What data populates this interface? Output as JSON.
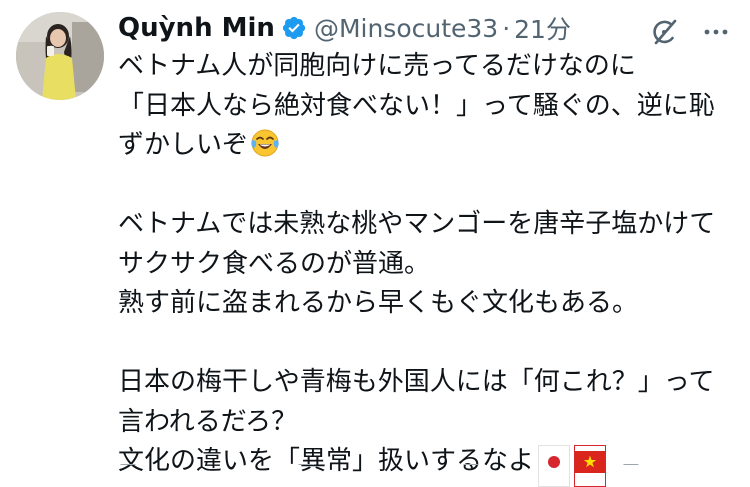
{
  "tweet": {
    "display_name": "Quỳnh Min",
    "handle": "@Minsocute33",
    "separator": "·",
    "time": "21分",
    "icons": {
      "verified": "verified-badge-icon",
      "grok": "grok-icon",
      "more": "more-options-icon"
    },
    "colors": {
      "verified": "#1d9bf0",
      "secondary_text": "#536471",
      "primary_text": "#0f1419"
    },
    "lines": [
      "ベトナム人が同胞向けに売ってるだけなのに",
      "「日本人なら絶対食べない！」って騒ぐの、逆に恥",
      "ずかしいぞ",
      "",
      "ベトナムでは未熟な桃やマンゴーを唐辛子塩かけて",
      "サクサク食べるのが普通。",
      "熟す前に盗まれるから早くもぐ文化もある。",
      "",
      "日本の梅干しや青梅も外国人には「何これ？」って",
      "言われるだろ？",
      "文化の違いを「異常」扱いするなよ"
    ],
    "emojis": {
      "laughing": "face-with-tears-of-joy-icon",
      "flag_japan": "japan-flag-icon",
      "flag_vietnam": "vietnam-flag-icon"
    }
  }
}
